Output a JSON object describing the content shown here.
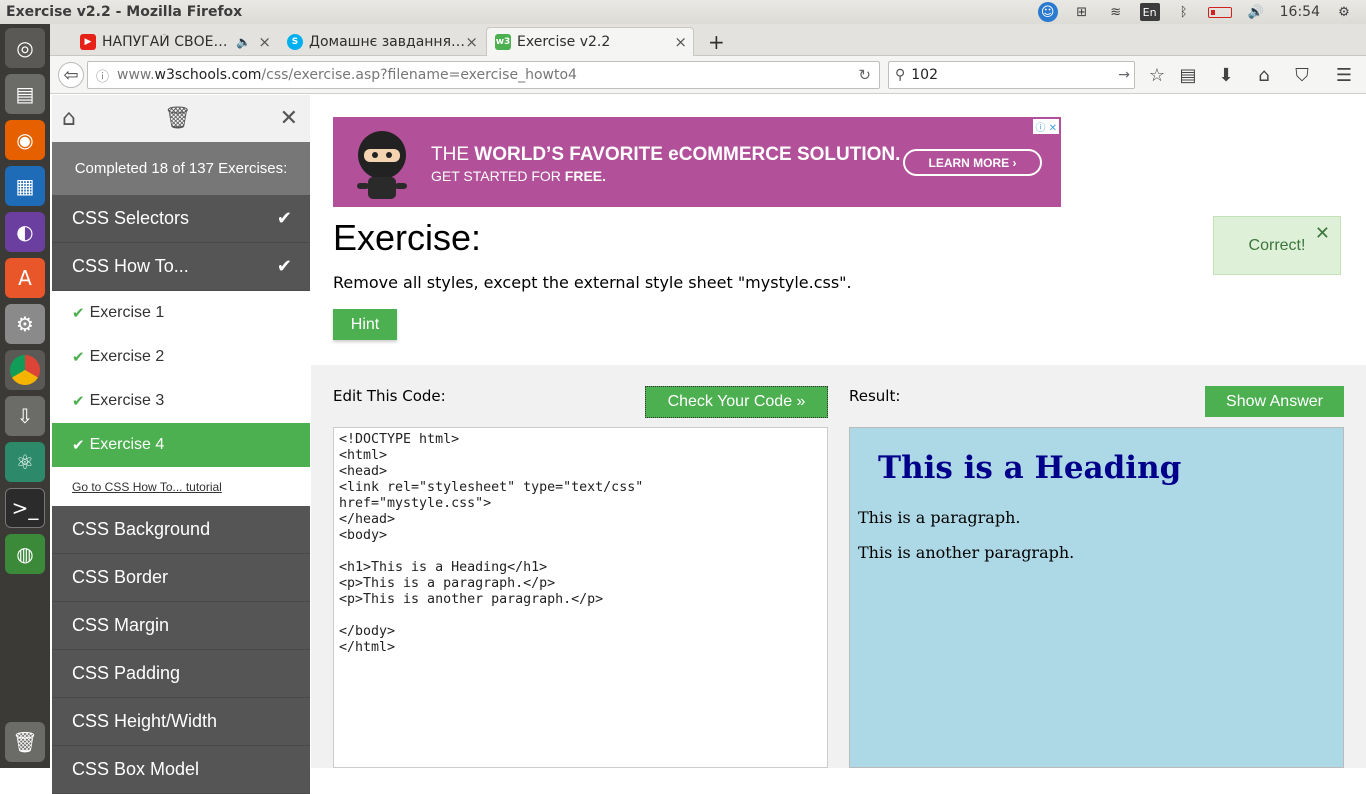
{
  "window": {
    "title": "Exercise v2.2 - Mozilla Firefox",
    "time": "16:54",
    "keyboard": "En"
  },
  "tabs": [
    {
      "label": "НАПУГАЙ СВОЕ…",
      "icon": "youtube-icon"
    },
    {
      "label": "Домашнє завдання…",
      "icon": "skype-icon"
    },
    {
      "label": "Exercise v2.2",
      "icon": "w3schools-icon"
    }
  ],
  "nav": {
    "url_prefix": "www.",
    "url_domain": "w3schools.com",
    "url_path": "/css/exercise.asp?filename=exercise_howto4",
    "search_value": "102"
  },
  "sidebar": {
    "completed": "Completed 18 of 137 Exercises:",
    "sections_top": [
      {
        "label": "CSS Selectors",
        "done": true
      },
      {
        "label": "CSS How To...",
        "done": true
      }
    ],
    "exercises": [
      "Exercise 1",
      "Exercise 2",
      "Exercise 3",
      "Exercise 4"
    ],
    "tutorial_link": "Go to CSS How To... tutorial",
    "sections_bottom": [
      "CSS Background",
      "CSS Border",
      "CSS Margin",
      "CSS Padding",
      "CSS Height/Width",
      "CSS Box Model"
    ]
  },
  "ad": {
    "line1_thin": "THE ",
    "line1_bold": "WORLD’S FAVORITE eCOMMERCE SOLUTION.",
    "line2_thin": "GET STARTED FOR ",
    "line2_bold": "FREE.",
    "button": "LEARN MORE ›"
  },
  "exercise": {
    "heading": "Exercise:",
    "description": "Remove all styles, except the external style sheet \"mystyle.css\".",
    "hint": "Hint",
    "correct": "Correct!"
  },
  "editor": {
    "label": "Edit This Code:",
    "check_button": "Check Your Code »",
    "code": "<!DOCTYPE html>\n<html>\n<head>\n<link rel=\"stylesheet\" type=\"text/css\"\nhref=\"mystyle.css\">\n</head>\n<body>\n\n<h1>This is a Heading</h1>\n<p>This is a paragraph.</p>\n<p>This is another paragraph.</p>\n\n</body>\n</html>"
  },
  "result": {
    "label": "Result:",
    "show_answer": "Show Answer",
    "heading": "This is a Heading",
    "para1": "This is a paragraph.",
    "para2": "This is another paragraph."
  }
}
